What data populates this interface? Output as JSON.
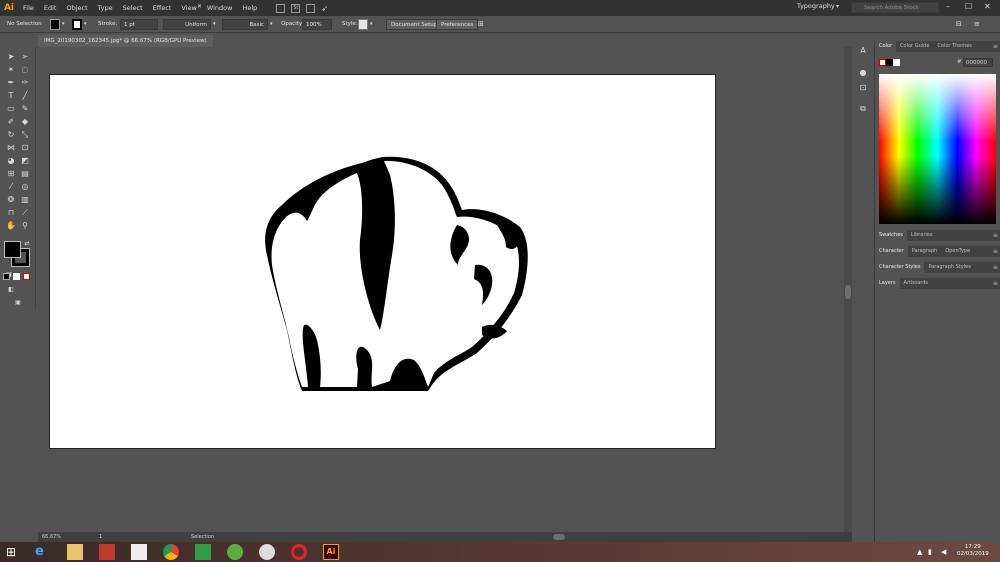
{
  "app": {
    "logo": "Ai",
    "workspace": "Typography",
    "search_placeholder": "Search Adobe Stock"
  },
  "menu": [
    "File",
    "Edit",
    "Object",
    "Type",
    "Select",
    "Effect",
    "View",
    "Window",
    "Help"
  ],
  "menu_icons": {
    "br": "Br",
    "st": "St"
  },
  "window_controls": {
    "minimize": "–",
    "maximize": "☐",
    "close": "✕"
  },
  "control_bar": {
    "selection": "No Selection",
    "stroke_label": "Stroke:",
    "stroke_weight": "1 pt",
    "profile": "Uniform",
    "brush": "Basic",
    "opacity_label": "Opacity:",
    "opacity_value": "100%",
    "style_label": "Style:",
    "document_setup": "Document Setup",
    "preferences": "Preferences"
  },
  "document": {
    "tab_title": "IMG_20190302_162345.jpg* @ 66.67% (RGB/GPU Preview)",
    "close": "✕"
  },
  "status": {
    "zoom": "66.67%",
    "artboard": "1",
    "tool": "Selection"
  },
  "panels": {
    "color_tabs": [
      "Color",
      "Color Guide",
      "Color Themes"
    ],
    "hex_label": "#",
    "hex_value": "000000",
    "swatches_tabs": [
      "Swatches",
      "Libraries"
    ],
    "character_tabs": [
      "Character",
      "Paragraph",
      "OpenType"
    ],
    "char_styles_tabs": [
      "Character Styles",
      "Paragraph Styles"
    ],
    "layers_tabs": [
      "Layers",
      "Artboards"
    ]
  },
  "clock": {
    "time": "17:29",
    "date": "02/03/2019"
  },
  "colors": {
    "chrome": "#323232",
    "panel": "#535353",
    "artboard": "#ffffff",
    "accent": "#ff9a00",
    "fill": "#000000"
  }
}
